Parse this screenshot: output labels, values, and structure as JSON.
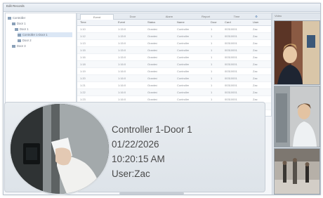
{
  "window": {
    "title": "Edit Records"
  },
  "tree": {
    "items": [
      "Controller",
      "Door 1",
      "Door 1",
      "Controller 1-Door 1",
      "Door 2",
      "Door 3"
    ]
  },
  "grid": {
    "tabs": [
      "Event",
      "Door",
      "Alarm",
      "Report",
      "Time"
    ],
    "columns": [
      "Time",
      "Event",
      "Status",
      "Name",
      "Door",
      "Card",
      "User"
    ],
    "rows": [
      [
        "1:10",
        "1:15:0",
        "Granted",
        "Controller",
        "1",
        "00310001",
        "Zac"
      ],
      [
        "1:12",
        "1:15:0",
        "Granted",
        "Controller",
        "1",
        "00310001",
        "Zac"
      ],
      [
        "1:13",
        "1:15:0",
        "Granted",
        "Controller",
        "1",
        "00310001",
        "Zac"
      ],
      [
        "1:15",
        "1:15:0",
        "Granted",
        "Controller",
        "1",
        "00310001",
        "Zac"
      ],
      [
        "1:16",
        "1:15:0",
        "Granted",
        "Controller",
        "1",
        "00310001",
        "Zac"
      ],
      [
        "1:18",
        "1:16:0",
        "Granted",
        "Controller",
        "1",
        "00310001",
        "Zac"
      ],
      [
        "1:19",
        "1:16:0",
        "Granted",
        "Controller",
        "1",
        "00310001",
        "Zac"
      ],
      [
        "1:20",
        "1:16:0",
        "Granted",
        "Controller",
        "1",
        "00310001",
        "Zac"
      ],
      [
        "1:21",
        "1:16:0",
        "Granted",
        "Controller",
        "1",
        "00310001",
        "Zac"
      ],
      [
        "1:22",
        "1:16:0",
        "Granted",
        "Controller",
        "1",
        "00310001",
        "Zac"
      ],
      [
        "1:23",
        "1:16:0",
        "Granted",
        "Controller",
        "1",
        "00310001",
        "Zac"
      ],
      [
        "1:24",
        "1:16:0",
        "Granted",
        "Controller",
        "1",
        "00310001",
        "Zac"
      ]
    ]
  },
  "video": {
    "header": "Video"
  },
  "popup": {
    "door": "Controller 1-Door 1",
    "date": "01/22/2026",
    "time": "10:20:15 AM",
    "user": "User:Zac"
  }
}
